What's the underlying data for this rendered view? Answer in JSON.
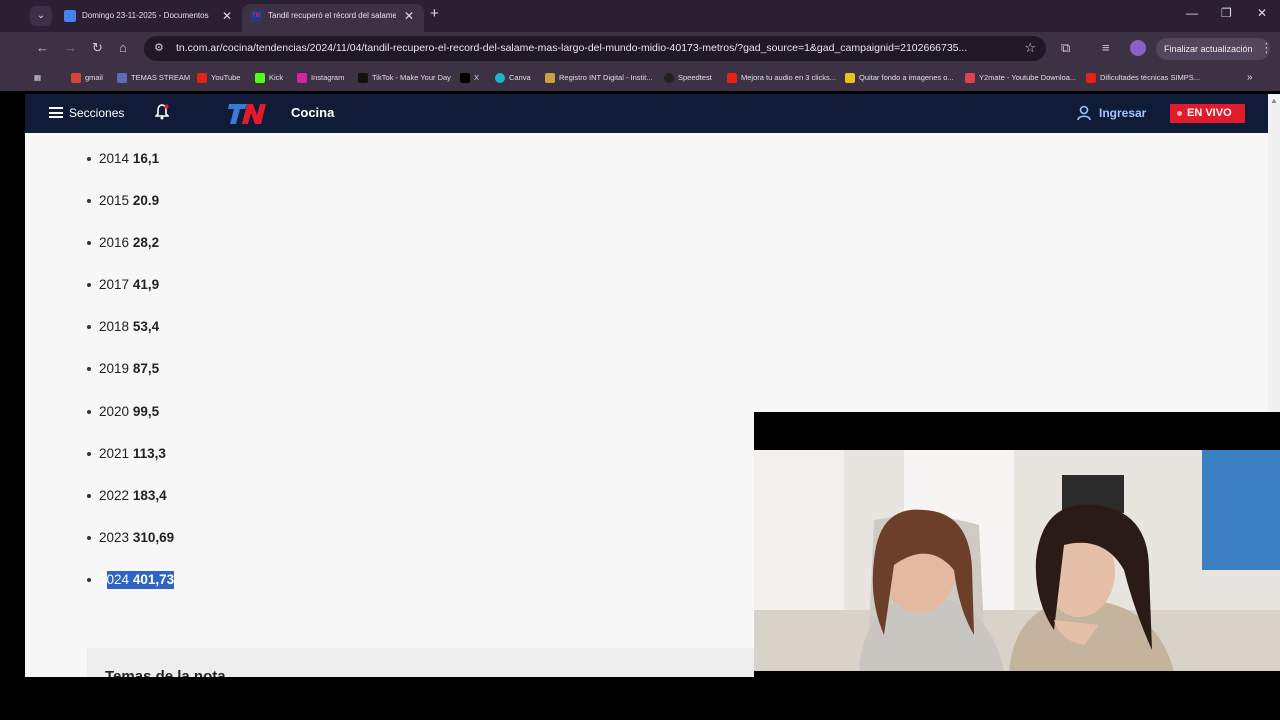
{
  "browser": {
    "tabs": [
      {
        "title": "Domingo 23-11-2025 - Documentos de G",
        "active": false
      },
      {
        "title": "Tandil recuperó el récord del salame más l",
        "active": true
      }
    ],
    "url": "tn.com.ar/cocina/tendencias/2024/11/04/tandil-recupero-el-record-del-salame-mas-largo-del-mundo-midio-40173-metros/?gad_source=1&gad_campaignid=2102666735...",
    "update_button": "Finalizar actualización",
    "bookmarks": [
      "gmail",
      "YouTube",
      "TEMAS STREAM",
      "Kick",
      "Instagram",
      "TikTok - Make Your Day",
      "X",
      "Canva",
      "Registro INT Digital - Instit...",
      "Speedtest",
      "Mejora tu audio en 3 clicks...",
      "Quitar fondo a imagenes o...",
      "Y2mate - Youtube Downloa...",
      "Dificultades técnicas SIMPS..."
    ]
  },
  "site": {
    "menu_label": "Secciones",
    "logo": "TN",
    "section": "Cocina",
    "login": "Ingresar",
    "live": "EN VIVO"
  },
  "article": {
    "records": [
      {
        "year": "2014",
        "value": "16,1"
      },
      {
        "year": "2015",
        "value": "20.9"
      },
      {
        "year": "2016",
        "value": "28,2"
      },
      {
        "year": "2017",
        "value": "41,9"
      },
      {
        "year": "2018",
        "value": "53,4"
      },
      {
        "year": "2019",
        "value": "87,5"
      },
      {
        "year": "2020",
        "value": "99,5"
      },
      {
        "year": "2021",
        "value": "113,3"
      },
      {
        "year": "2022",
        "value": "183,4"
      },
      {
        "year": "2023",
        "value": "310,69"
      },
      {
        "year": "2024",
        "value": "401,73"
      }
    ],
    "tags_title": "Temas de la nota"
  },
  "colors": {
    "tabbar": "#2a1f33",
    "toolbar": "#3c3244",
    "site_header": "#0f1b37",
    "live_red": "#e21a2c",
    "selection": "#2f63c4"
  }
}
